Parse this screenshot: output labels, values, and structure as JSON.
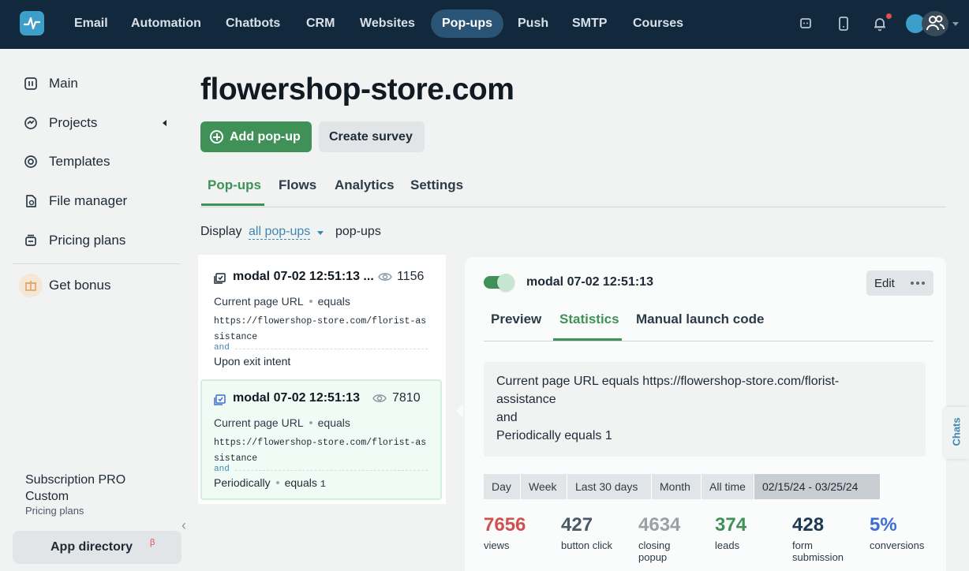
{
  "topnav": {
    "items": [
      {
        "label": "Email"
      },
      {
        "label": "Automation"
      },
      {
        "label": "Chatbots"
      },
      {
        "label": "CRM"
      },
      {
        "label": "Websites"
      },
      {
        "label": "Pop-ups",
        "active": true
      },
      {
        "label": "Push"
      },
      {
        "label": "SMTP"
      },
      {
        "label": "Courses"
      }
    ],
    "icons": [
      "chat-icon",
      "mobile-icon",
      "bell-icon",
      "avatar-icon"
    ]
  },
  "sidebar": {
    "items": [
      {
        "label": "Main",
        "icon": "home-icon"
      },
      {
        "label": "Projects",
        "icon": "projects-icon"
      },
      {
        "label": "Templates",
        "icon": "templates-icon"
      },
      {
        "label": "File manager",
        "icon": "file-icon"
      },
      {
        "label": "Pricing plans",
        "icon": "pricing-icon"
      },
      {
        "label": "Get bonus",
        "icon": "gift-icon"
      }
    ],
    "subscription": {
      "title": "Subscription PRO Custom",
      "link": "Pricing plans"
    },
    "app_directory": {
      "label": "App directory",
      "badge": "β"
    }
  },
  "main": {
    "title": "flowershop-store.com",
    "add_button": "Add pop-up",
    "survey_button": "Create survey",
    "tabs": [
      {
        "label": "Pop-ups",
        "active": true
      },
      {
        "label": "Flows"
      },
      {
        "label": "Analytics"
      },
      {
        "label": "Settings"
      }
    ],
    "display": {
      "prefix": "Display",
      "filter": "all pop-ups",
      "suffix": "pop-ups"
    }
  },
  "popups": [
    {
      "name": "modal 07-02 12:51:13 ...",
      "views": "1156",
      "condition_field": "Current page URL",
      "condition_op": "equals",
      "url": "https://flowershop-store.com/florist-assistance",
      "joiner": "and",
      "trigger": "Upon exit intent",
      "trigger_op": "",
      "trigger_value": ""
    },
    {
      "name": "modal 07-02 12:51:13",
      "views": "7810",
      "condition_field": "Current page URL",
      "condition_op": "equals",
      "url": "https://flowershop-store.com/florist-assistance",
      "joiner": "and",
      "trigger": "Periodically",
      "trigger_op": "equals",
      "trigger_value": "1",
      "selected": true
    }
  ],
  "detail": {
    "name": "modal 07-02 12:51:13",
    "enabled": true,
    "edit": "Edit",
    "tabs": [
      {
        "label": "Preview"
      },
      {
        "label": "Statistics",
        "active": true
      },
      {
        "label": "Manual launch code"
      }
    ],
    "conditions": [
      "Current page URL equals https://flowershop-store.com/florist-",
      "assistance",
      "and",
      "Periodically equals 1"
    ],
    "periods": [
      "Day",
      "Week",
      "Last 30 days",
      "Month",
      "All time",
      "02/15/24 - 03/25/24"
    ],
    "stats": [
      {
        "value": "7656",
        "label": "views",
        "color": "#d05050"
      },
      {
        "value": "427",
        "label": "button click",
        "color": "#4b5967"
      },
      {
        "value": "4634",
        "label": "closing popup",
        "color": "#9aa0a6"
      },
      {
        "value": "374",
        "label": "leads",
        "color": "#3f9158"
      },
      {
        "value": "428",
        "label": "form submission",
        "color": "#1d3a52"
      },
      {
        "value": "5%",
        "label": "conversions",
        "color": "#3d6fd0"
      }
    ]
  },
  "chats_tab": "Chats",
  "colors": {
    "topbar": "#12283c",
    "accent": "#3f9158",
    "link": "#3d87b3"
  }
}
